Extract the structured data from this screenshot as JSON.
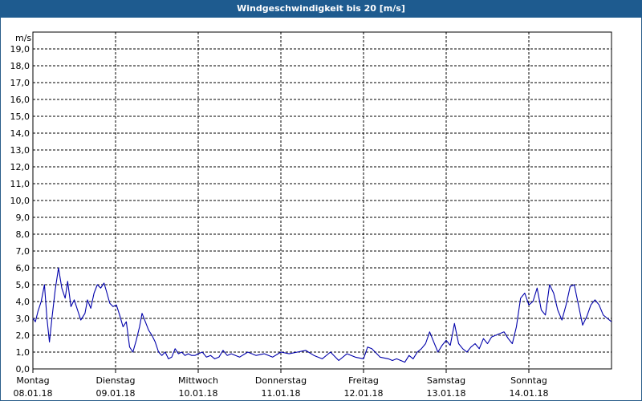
{
  "chart_data": {
    "type": "line",
    "title": "Windgeschwindigkeit bis 20 [m/s]",
    "ylabel": "m/s",
    "ylim": [
      0,
      20
    ],
    "yticks": [
      "0,0",
      "1,0",
      "2,0",
      "3,0",
      "4,0",
      "5,0",
      "6,0",
      "7,0",
      "8,0",
      "9,0",
      "10,0",
      "11,0",
      "12,0",
      "13,0",
      "14,0",
      "15,0",
      "16,0",
      "17,0",
      "18,0",
      "19,0"
    ],
    "xlim": [
      0,
      7
    ],
    "xticks": [
      {
        "day": "Montag",
        "date": "08.01.18"
      },
      {
        "day": "Dienstag",
        "date": "09.01.18"
      },
      {
        "day": "Mittwoch",
        "date": "10.01.18"
      },
      {
        "day": "Donnerstag",
        "date": "11.01.18"
      },
      {
        "day": "Freitag",
        "date": "12.01.18"
      },
      {
        "day": "Samstag",
        "date": "13.01.18"
      },
      {
        "day": "Sonntag",
        "date": "14.01.18"
      }
    ],
    "grid": true,
    "series": [
      {
        "color": "#0000aa",
        "x": [
          0,
          0.03,
          0.06,
          0.1,
          0.14,
          0.17,
          0.2,
          0.23,
          0.27,
          0.31,
          0.35,
          0.39,
          0.42,
          0.46,
          0.5,
          0.54,
          0.58,
          0.63,
          0.66,
          0.7,
          0.74,
          0.78,
          0.82,
          0.86,
          0.89,
          0.93,
          0.97,
          1.01,
          1.05,
          1.09,
          1.13,
          1.17,
          1.21,
          1.25,
          1.29,
          1.32,
          1.36,
          1.4,
          1.44,
          1.48,
          1.52,
          1.56,
          1.6,
          1.64,
          1.68,
          1.72,
          1.76,
          1.8,
          1.84,
          1.88,
          1.92,
          1.96,
          2,
          2.05,
          2.1,
          2.15,
          2.2,
          2.25,
          2.3,
          2.35,
          2.4,
          2.5,
          2.6,
          2.7,
          2.8,
          2.9,
          3,
          3.1,
          3.2,
          3.3,
          3.4,
          3.5,
          3.6,
          3.7,
          3.8,
          3.9,
          4,
          4.05,
          4.1,
          4.2,
          4.3,
          4.35,
          4.4,
          4.45,
          4.5,
          4.55,
          4.6,
          4.65,
          4.7,
          4.75,
          4.8,
          4.85,
          4.9,
          4.95,
          5,
          5.05,
          5.1,
          5.15,
          5.2,
          5.25,
          5.3,
          5.35,
          5.4,
          5.45,
          5.5,
          5.55,
          5.6,
          5.65,
          5.7,
          5.75,
          5.8,
          5.85,
          5.9,
          5.95,
          6,
          6.05,
          6.1,
          6.15,
          6.2,
          6.25,
          6.3,
          6.35,
          6.4,
          6.45,
          6.5,
          6.55,
          6.6,
          6.65,
          6.7,
          6.75,
          6.8,
          6.85,
          6.9,
          6.95,
          7
        ],
        "y": [
          3,
          2.8,
          3.4,
          4,
          5,
          3,
          1.6,
          3,
          4.7,
          6,
          4.8,
          4.2,
          5.2,
          3.7,
          4.1,
          3.5,
          2.9,
          3.3,
          4.1,
          3.6,
          4.5,
          5,
          4.8,
          5.1,
          4.6,
          3.9,
          3.7,
          3.8,
          3.2,
          2.5,
          2.8,
          1.3,
          1,
          1.7,
          2.5,
          3.3,
          2.8,
          2.3,
          2,
          1.6,
          1,
          0.8,
          1,
          0.6,
          0.7,
          1.2,
          0.9,
          1,
          0.8,
          0.9,
          0.8,
          0.8,
          0.9,
          1,
          0.7,
          0.8,
          0.6,
          0.7,
          1.1,
          0.8,
          0.9,
          0.7,
          1,
          0.8,
          0.9,
          0.7,
          1,
          0.9,
          1,
          1.1,
          0.8,
          0.6,
          1,
          0.5,
          0.9,
          0.7,
          0.6,
          1.3,
          1.2,
          0.7,
          0.6,
          0.5,
          0.6,
          0.5,
          0.4,
          0.8,
          0.6,
          1.0,
          1.2,
          1.5,
          2.2,
          1.6,
          1.0,
          1.4,
          1.7,
          1.4,
          2.7,
          1.5,
          1.2,
          1.0,
          1.3,
          1.5,
          1.2,
          1.8,
          1.5,
          1.9,
          2.0,
          2.1,
          2.2,
          1.8,
          1.5,
          2.5,
          4.2,
          4.5,
          3.8,
          4.0,
          4.8,
          3.5,
          3.2,
          5.0,
          4.5,
          3.5,
          2.9,
          3.8,
          4.9,
          5.0,
          3.8,
          2.6,
          3.1,
          3.8,
          4.1,
          3.8,
          3.2,
          3.0,
          2.8
        ]
      }
    ]
  }
}
